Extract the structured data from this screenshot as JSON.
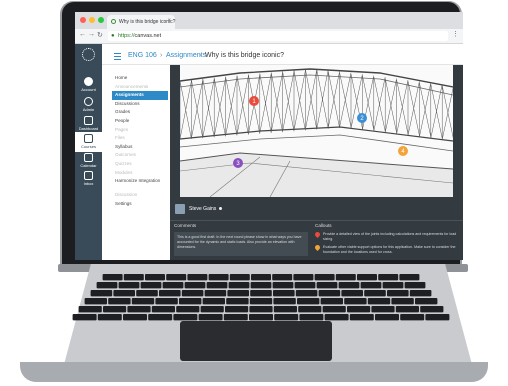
{
  "browser": {
    "tab_title": "Why is this bridge iconic?",
    "tab_close": "×",
    "url_secure": "https://",
    "url_host": "canvas.net",
    "nav_back": "←",
    "nav_forward": "→",
    "nav_reload": "↻",
    "lock_icon": "🔒",
    "menu": "⋮",
    "traffic_colors": [
      "#ff5f57",
      "#febc2e",
      "#28c840"
    ]
  },
  "global_nav": {
    "items": [
      {
        "label": "Account"
      },
      {
        "label": "Admin"
      },
      {
        "label": "Dashboard"
      },
      {
        "label": "Courses"
      },
      {
        "label": "Calendar"
      },
      {
        "label": "Inbox"
      }
    ]
  },
  "breadcrumb": {
    "course": "ENG 106",
    "sep": "›",
    "assignments": "Assignments",
    "page": "Why is this bridge iconic?"
  },
  "course_nav": [
    {
      "label": "Home",
      "state": "normal"
    },
    {
      "label": "Announcements",
      "state": "muted"
    },
    {
      "label": "Assignments",
      "state": "active"
    },
    {
      "label": "Discussions",
      "state": "normal"
    },
    {
      "label": "Grades",
      "state": "normal"
    },
    {
      "label": "People",
      "state": "normal"
    },
    {
      "label": "Pages",
      "state": "muted"
    },
    {
      "label": "Files",
      "state": "muted"
    },
    {
      "label": "Syllabus",
      "state": "normal"
    },
    {
      "label": "Outcomes",
      "state": "muted"
    },
    {
      "label": "Quizzes",
      "state": "muted"
    },
    {
      "label": "Modules",
      "state": "muted"
    },
    {
      "label": "Harmonize Integration",
      "state": "normal"
    },
    {
      "label": "Discussion",
      "state": "muted"
    },
    {
      "label": "Settings",
      "state": "normal"
    }
  ],
  "viewer": {
    "user_name": "Steve Gains",
    "comments_header": "Comments",
    "callouts_header": "Callouts",
    "comment_text": "This is a good first draft. In the next round please show in what ways you have accounted for the dynamic and static loads. Also provide an elevation with dimensions.",
    "callouts": [
      {
        "text": "Provide a detailed view of the joints including calculations and requirements for load sizing.",
        "color": "#e94b3c"
      },
      {
        "text": "Evaluate other viable support options for this application. Make sure to consider the foundation and the locations used for cross.",
        "color": "#f2a33a"
      }
    ],
    "markers": [
      {
        "num": "1",
        "color": "#e94b3c"
      },
      {
        "num": "2",
        "color": "#3a8fd6"
      },
      {
        "num": "3",
        "color": "#8a4fbf"
      },
      {
        "num": "4",
        "color": "#f2a33a"
      }
    ]
  }
}
